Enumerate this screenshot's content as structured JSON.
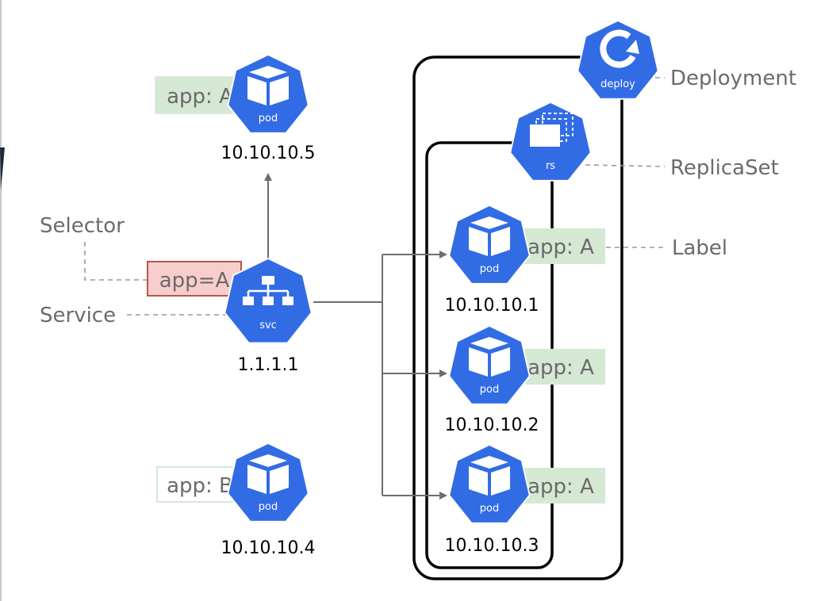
{
  "colors": {
    "k8s_blue": "#326ce5",
    "label_green": "#d5e8d4",
    "label_green_border": "#d5e8d4",
    "selector_red_fill": "#f8cecc",
    "selector_red_border": "#b85450",
    "arrow_gray": "#6d6d6d",
    "dashed_gray": "#9a9a9a"
  },
  "nodes": {
    "pod5": {
      "type": "pod",
      "icon": "pod-cube-icon",
      "caption": "pod",
      "ip": "10.10.10.5",
      "label": "app: A"
    },
    "svc": {
      "type": "svc",
      "icon": "service-network-icon",
      "caption": "svc",
      "ip": "1.1.1.1",
      "selector": "app=A"
    },
    "pod4": {
      "type": "pod",
      "icon": "pod-cube-icon",
      "caption": "pod",
      "ip": "10.10.10.4",
      "label": "app: B"
    },
    "pod1": {
      "type": "pod",
      "icon": "pod-cube-icon",
      "caption": "pod",
      "ip": "10.10.10.1",
      "label": "app: A"
    },
    "pod2": {
      "type": "pod",
      "icon": "pod-cube-icon",
      "caption": "pod",
      "ip": "10.10.10.2",
      "label": "app: A"
    },
    "pod3": {
      "type": "pod",
      "icon": "pod-cube-icon",
      "caption": "pod",
      "ip": "10.10.10.3",
      "label": "app: A"
    },
    "rs": {
      "type": "rs",
      "icon": "replicaset-stack-icon",
      "caption": "rs"
    },
    "deploy": {
      "type": "deploy",
      "icon": "deployment-refresh-icon",
      "caption": "deploy"
    }
  },
  "callouts": {
    "deployment": "Deployment",
    "replicaset": "ReplicaSet",
    "label": "Label",
    "selector": "Selector",
    "service": "Service"
  },
  "edges": [
    {
      "from": "svc",
      "to": "pod5",
      "style": "arrow"
    },
    {
      "from": "svc",
      "to": "pod1",
      "style": "arrow"
    },
    {
      "from": "svc",
      "to": "pod2",
      "style": "arrow"
    },
    {
      "from": "svc",
      "to": "pod3",
      "style": "arrow"
    }
  ]
}
